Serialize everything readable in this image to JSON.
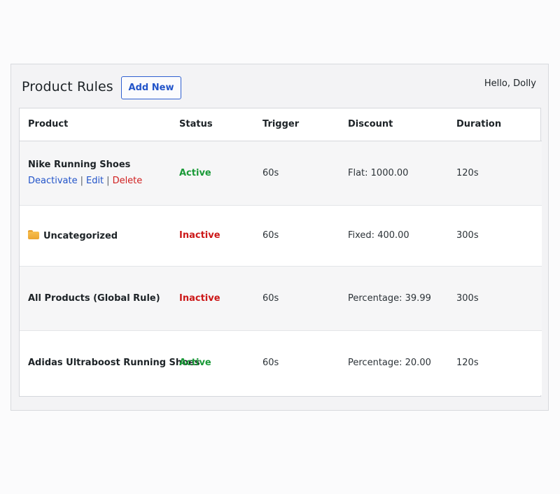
{
  "header": {
    "title": "Product Rules",
    "add_new_label": "Add New",
    "greeting": "Hello, Dolly"
  },
  "table": {
    "columns": [
      "Product",
      "Status",
      "Trigger",
      "Discount",
      "Duration"
    ],
    "rows": [
      {
        "product": "Nike Running Shoes",
        "icon": "",
        "status": "Active",
        "trigger": "60s",
        "discount": "Flat: 1000.00",
        "duration": "120s",
        "actions": {
          "deactivate": "Deactivate",
          "edit": "Edit",
          "delete": "Delete",
          "separator": "|"
        }
      },
      {
        "product": "Uncategorized",
        "icon": "folder-icon",
        "status": "Inactive",
        "trigger": "60s",
        "discount": "Fixed: 400.00",
        "duration": "300s"
      },
      {
        "product": "All Products (Global Rule)",
        "icon": "",
        "status": "Inactive",
        "trigger": "60s",
        "discount": "Percentage: 39.99",
        "duration": "300s"
      },
      {
        "product": "Adidas Ultraboost Running Shoes",
        "icon": "",
        "status": "Active",
        "trigger": "60s",
        "discount": "Percentage: 20.00",
        "duration": "120s"
      }
    ]
  },
  "colors": {
    "accent": "#2254c9",
    "active": "#1a9a38",
    "inactive": "#cc1818",
    "delete": "#d01f1f",
    "folder": "#f0aa36"
  }
}
